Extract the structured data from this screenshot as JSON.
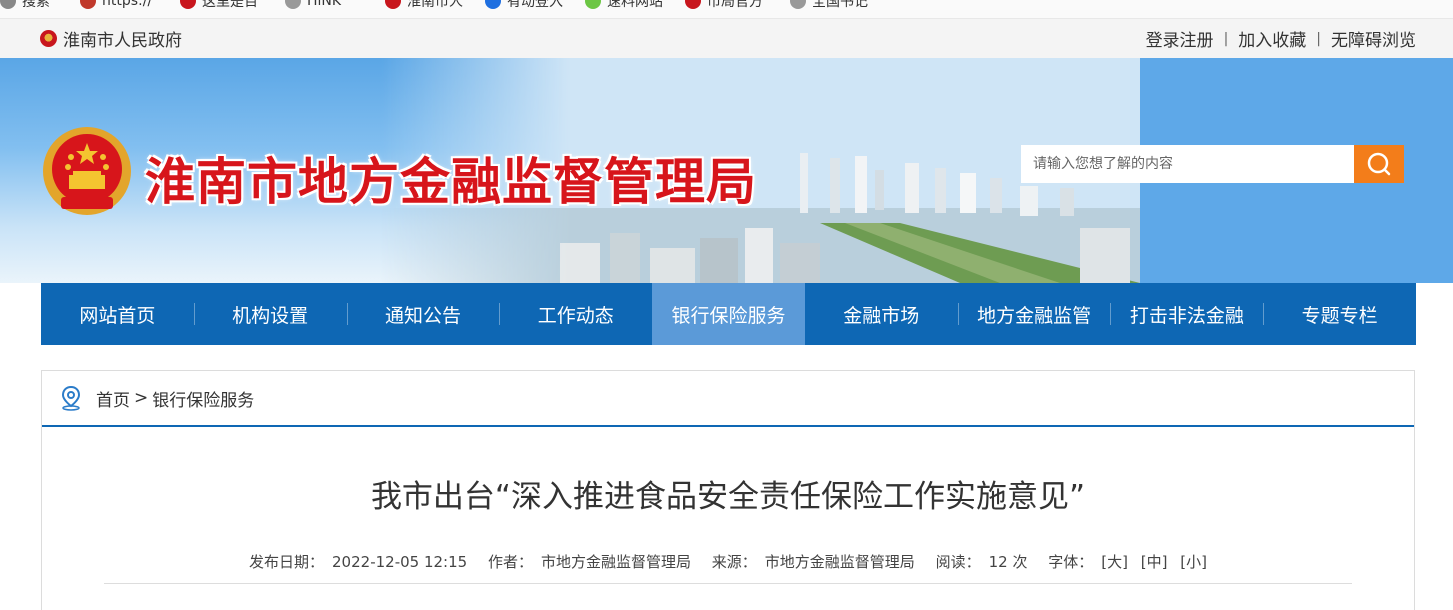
{
  "browser_bookmarks": [
    {
      "label": "搜索",
      "color": "#888888"
    },
    {
      "label": "https://",
      "color": "#c0392b"
    },
    {
      "label": "这里是百",
      "color": "#c8161d"
    },
    {
      "label": "HiNK",
      "color": "#999999"
    },
    {
      "label": "淮南市人",
      "color": "#c8161d"
    },
    {
      "label": "有动登入",
      "color": "#1f6fe0"
    },
    {
      "label": "速料网站",
      "color": "#6cc644"
    },
    {
      "label": "市局官方",
      "color": "#c8161d"
    },
    {
      "label": "全国书记",
      "color": "#999999"
    }
  ],
  "topbar": {
    "site_name": "淮南市人民政府",
    "links": [
      "登录注册",
      "加入收藏",
      "无障碍浏览"
    ],
    "separator": "|"
  },
  "banner": {
    "title": "淮南市地方金融监督管理局",
    "title_color": "#d7151b",
    "search_placeholder": "请输入您想了解的内容",
    "search_button_color": "#f37d1a"
  },
  "nav": {
    "items": [
      "网站首页",
      "机构设置",
      "通知公告",
      "工作动态",
      "银行保险服务",
      "金融市场",
      "地方金融监管",
      "打击非法金融",
      "专题专栏"
    ],
    "active_index": 4,
    "bg_color": "#0e67b4",
    "active_color": "#5b9ad8"
  },
  "breadcrumb": {
    "home": "首页",
    "separator": ">",
    "current": "银行保险服务"
  },
  "article": {
    "title": "我市出台“深入推进食品安全责任保险工作实施意见”",
    "publish_label": "发布日期：",
    "publish_date": "2022-12-05 12:15",
    "author_label": "作者：",
    "author": "市地方金融监督管理局",
    "source_label": "来源：",
    "source": "市地方金融监督管理局",
    "reads_label": "阅读：",
    "reads": "12 次",
    "font_label": "字体：",
    "font_large": "[大]",
    "font_medium": "[中]",
    "font_small": "[小]"
  }
}
